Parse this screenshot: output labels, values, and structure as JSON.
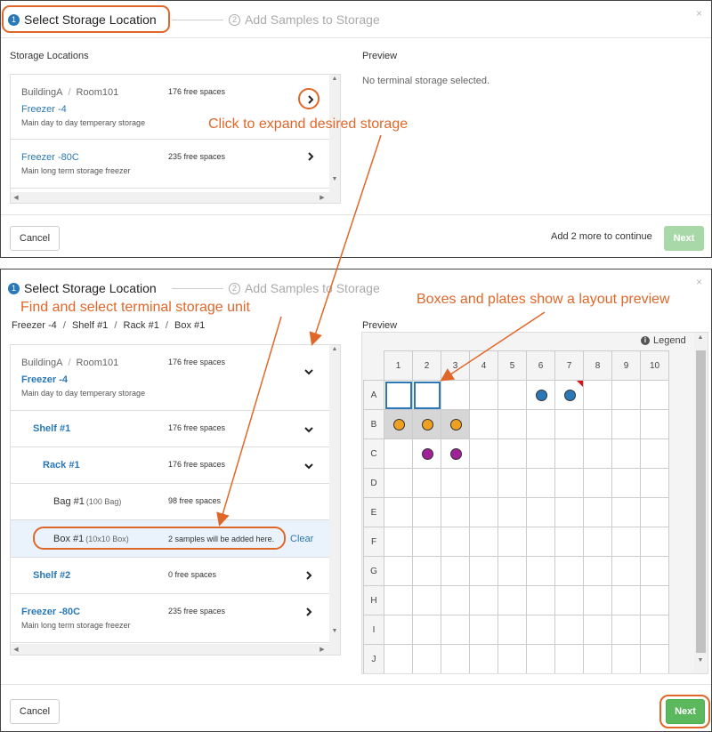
{
  "steps": {
    "step1_num": "1",
    "step1_label": "Select Storage Location",
    "step2_num": "2",
    "step2_label": "Add Samples to Storage"
  },
  "close_glyph": "×",
  "panel1": {
    "section_title": "Storage Locations",
    "preview_title": "Preview",
    "preview_empty": "No terminal storage selected.",
    "locations": [
      {
        "path_building": "BuildingA",
        "path_sep": "/",
        "path_room": "Room101",
        "name": "Freezer -4",
        "desc": "Main day to day temperary storage",
        "free": "176 free spaces"
      },
      {
        "name": "Freezer -80C",
        "desc": "Main long term storage freezer",
        "free": "235 free spaces"
      }
    ],
    "continue_msg": "Add 2 more to continue",
    "cancel_label": "Cancel",
    "next_label": "Next"
  },
  "annotations": {
    "expand": "Click to expand desired storage",
    "find": "Find and select terminal storage unit",
    "layout": "Boxes and plates show a layout preview"
  },
  "panel2": {
    "breadcrumb": [
      "Freezer -4",
      "Shelf #1",
      "Rack #1",
      "Box #1"
    ],
    "breadcrumb_sep": "/",
    "preview_title": "Preview",
    "legend_label": "Legend",
    "legend_icon_glyph": "i",
    "tree": {
      "building": "BuildingA",
      "sep": "/",
      "room": "Room101",
      "freezer_name": "Freezer -4",
      "freezer_desc": "Main day to day temperary storage",
      "freezer_free": "176 free spaces",
      "shelf1_name": "Shelf #1",
      "shelf1_free": "176 free spaces",
      "rack1_name": "Rack #1",
      "rack1_free": "176 free spaces",
      "bag_name": "Bag #1",
      "bag_type": "(100 Bag)",
      "bag_free": "98 free spaces",
      "box_name": "Box #1",
      "box_type": "(10x10 Box)",
      "box_msg": "2 samples will be added here.",
      "clear_label": "Clear",
      "shelf2_name": "Shelf #2",
      "shelf2_free": "0 free spaces",
      "freezer80_name": "Freezer -80C",
      "freezer80_desc": "Main long term storage freezer",
      "freezer80_free": "235 free spaces"
    },
    "grid": {
      "columns": [
        "1",
        "2",
        "3",
        "4",
        "5",
        "6",
        "7",
        "8",
        "9",
        "10"
      ],
      "rows": [
        "A",
        "B",
        "C",
        "D",
        "E",
        "F",
        "G",
        "H",
        "I",
        "J"
      ],
      "selected": [
        [
          "A",
          1
        ],
        [
          "A",
          2
        ]
      ],
      "filled": [
        {
          "row": "A",
          "col": 6,
          "color": "#2a78b7"
        },
        {
          "row": "A",
          "col": 7,
          "color": "#2a78b7",
          "flag": true
        },
        {
          "row": "B",
          "col": 1,
          "color": "#f0a020"
        },
        {
          "row": "B",
          "col": 2,
          "color": "#f0a020"
        },
        {
          "row": "B",
          "col": 3,
          "color": "#f0a020"
        },
        {
          "row": "C",
          "col": 2,
          "color": "#a0229a"
        },
        {
          "row": "C",
          "col": 3,
          "color": "#a0229a"
        }
      ]
    },
    "cancel_label": "Cancel",
    "next_label": "Next"
  },
  "colors": {
    "accent": "#2a78b7",
    "annotation": "#e0672a",
    "next_green": "#5cb85c"
  }
}
